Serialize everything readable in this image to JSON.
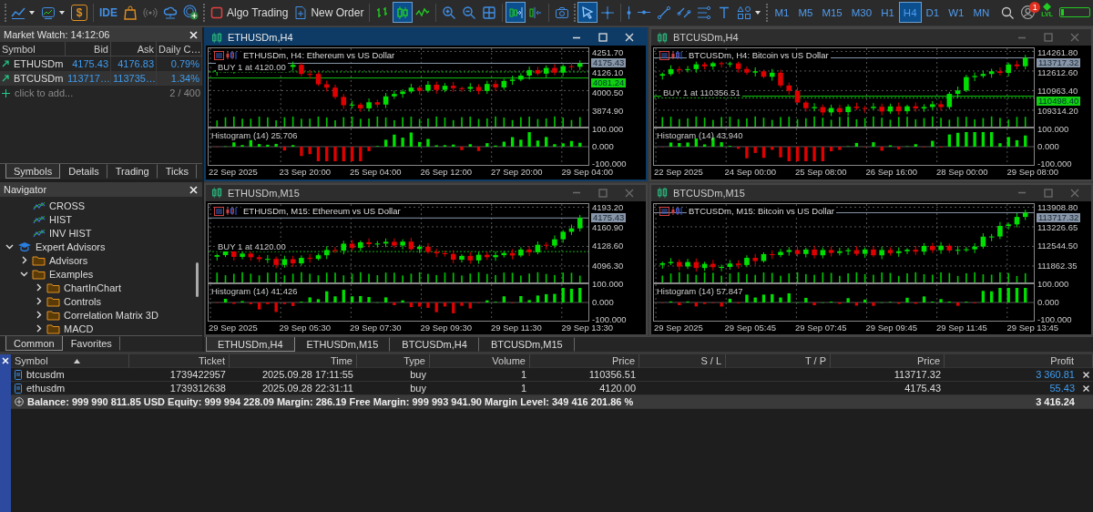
{
  "toolbar": {
    "ide": "IDE",
    "deposit_symbol": "$",
    "algo_trading": "Algo Trading",
    "new_order": "New Order",
    "toggles": [
      {
        "selected": false
      },
      {
        "selected": true
      },
      {
        "selected": false
      },
      {
        "selected": false
      },
      {
        "selected": false
      },
      {
        "selected": false
      },
      {
        "selected": true
      },
      {
        "selected": false
      },
      {
        "selected": false
      },
      {
        "selected": true
      },
      {
        "selected": false
      },
      {
        "selected": false
      },
      {
        "selected": false
      },
      {
        "selected": false
      },
      {
        "selected": false
      },
      {
        "selected": false
      },
      {
        "selected": false
      },
      {
        "selected": false
      }
    ],
    "timeframes": [
      {
        "label": "M1",
        "selected": false
      },
      {
        "label": "M5",
        "selected": false
      },
      {
        "label": "M15",
        "selected": false
      },
      {
        "label": "M30",
        "selected": false
      },
      {
        "label": "H1",
        "selected": false
      },
      {
        "label": "H4",
        "selected": true
      },
      {
        "label": "D1",
        "selected": false
      },
      {
        "label": "W1",
        "selected": false
      },
      {
        "label": "MN",
        "selected": false
      }
    ],
    "notification_count": "1",
    "level_label": "LVL"
  },
  "market_watch": {
    "title": "Market Watch: 14:12:06",
    "columns": [
      "Symbol",
      "Bid",
      "Ask",
      "Daily C…"
    ],
    "rows": [
      {
        "symbol": "ETHUSDm",
        "bid": "4175.43",
        "ask": "4176.83",
        "change": "0.79%",
        "selected": false
      },
      {
        "symbol": "BTCUSDm",
        "bid": "113717…",
        "ask": "113735…",
        "change": "1.34%",
        "selected": true
      }
    ],
    "add_label": "click to add...",
    "count": "2 / 400",
    "tabs": [
      {
        "label": "Symbols",
        "selected": true
      },
      {
        "label": "Details",
        "selected": false
      },
      {
        "label": "Trading",
        "selected": false
      },
      {
        "label": "Ticks",
        "selected": false
      }
    ]
  },
  "navigator": {
    "title": "Navigator",
    "tree": [
      {
        "label": "CROSS",
        "kind": "indicator"
      },
      {
        "label": "HIST",
        "kind": "indicator"
      },
      {
        "label": "INV HIST",
        "kind": "indicator"
      },
      {
        "label": "Expert Advisors",
        "kind": "experts",
        "expanded": true,
        "children": [
          {
            "label": "Advisors",
            "kind": "folder",
            "expanded": false
          },
          {
            "label": "Examples",
            "kind": "folder",
            "expanded": true,
            "children": [
              {
                "label": "ChartInChart",
                "kind": "folder",
                "expanded": false
              },
              {
                "label": "Controls",
                "kind": "folder",
                "expanded": false
              },
              {
                "label": "Correlation Matrix 3D",
                "kind": "folder",
                "expanded": false
              },
              {
                "label": "MACD",
                "kind": "folder",
                "expanded": false
              }
            ]
          }
        ]
      }
    ],
    "tabs": [
      {
        "label": "Common",
        "selected": true
      },
      {
        "label": "Favorites",
        "selected": false
      }
    ]
  },
  "charts": [
    {
      "title": "ETHUSDm,H4",
      "active": true,
      "header": "ETHUSDm, H4:  Ethereum vs US Dollar",
      "order_label": "BUY 1 at 4120.00",
      "price_ticks": [
        "4251.70",
        "4126.10",
        "4000.50",
        "3874.90"
      ],
      "price_tags": [
        {
          "value": "4175.43",
          "kind": "bid"
        },
        {
          "value": "4081.24",
          "kind": "level"
        }
      ],
      "indicator": "Histogram (14) 25.706",
      "indicator_ticks": [
        "100.000",
        "0.000",
        "-100.000"
      ],
      "time_labels": [
        "22 Sep 2025",
        "23 Sep 20:00",
        "25 Sep 04:00",
        "26 Sep 12:00",
        "27 Sep 20:00",
        "29 Sep 04:00"
      ]
    },
    {
      "title": "BTCUSDm,H4",
      "active": false,
      "header": "BTCUSDm, H4:  Bitcoin vs US Dollar",
      "order_label": "BUY 1 at 110356.51",
      "price_ticks": [
        "114261.80",
        "112612.60",
        "110963.40",
        "109314.20"
      ],
      "price_tags": [
        {
          "value": "113717.32",
          "kind": "bid"
        },
        {
          "value": "110498.40",
          "kind": "level"
        }
      ],
      "indicator": "Histogram (14) 43.940",
      "indicator_ticks": [
        "100.000",
        "0.000",
        "-100.000"
      ],
      "time_labels": [
        "22 Sep 2025",
        "24 Sep 00:00",
        "25 Sep 08:00",
        "26 Sep 16:00",
        "28 Sep 00:00",
        "29 Sep 08:00"
      ]
    },
    {
      "title": "ETHUSDm,M15",
      "active": false,
      "header": "ETHUSDm, M15:  Ethereum vs US Dollar",
      "order_label": "BUY 1 at 4120.00",
      "price_ticks": [
        "4193.20",
        "4160.90",
        "4128.60",
        "4096.30"
      ],
      "price_tags": [
        {
          "value": "4175.43",
          "kind": "bid"
        }
      ],
      "indicator": "Histogram (14) 41.426",
      "indicator_ticks": [
        "100.000",
        "0.000",
        "-100.000"
      ],
      "time_labels": [
        "29 Sep 2025",
        "29 Sep 05:30",
        "29 Sep 07:30",
        "29 Sep 09:30",
        "29 Sep 11:30",
        "29 Sep 13:30"
      ]
    },
    {
      "title": "BTCUSDm,M15",
      "active": false,
      "header": "BTCUSDm, M15:  Bitcoin vs US Dollar",
      "price_ticks": [
        "113908.80",
        "113226.65",
        "112544.50",
        "111862.35"
      ],
      "price_tags": [
        {
          "value": "113717.32",
          "kind": "bid"
        }
      ],
      "indicator": "Histogram (14) 57.847",
      "indicator_ticks": [
        "100.000",
        "0.000",
        "-100.000"
      ],
      "time_labels": [
        "29 Sep 2025",
        "29 Sep 05:45",
        "29 Sep 07:45",
        "29 Sep 09:45",
        "29 Sep 11:45",
        "29 Sep 13:45"
      ]
    }
  ],
  "chart_tabs": [
    {
      "label": "ETHUSDm,H4",
      "selected": true
    },
    {
      "label": "ETHUSDm,M15",
      "selected": false
    },
    {
      "label": "BTCUSDm,H4",
      "selected": false
    },
    {
      "label": "BTCUSDm,M15",
      "selected": false
    }
  ],
  "toolbox": {
    "columns": [
      "Symbol",
      "Ticket",
      "Time",
      "Type",
      "Volume",
      "Price",
      "S / L",
      "T / P",
      "Price",
      "Profit"
    ],
    "rows": [
      {
        "symbol": "btcusdm",
        "ticket": "1739422957",
        "time": "2025.09.28 17:11:55",
        "type": "buy",
        "volume": "1",
        "price": "110356.51",
        "current_price": "113717.32",
        "profit": "3 360.81"
      },
      {
        "symbol": "ethusdm",
        "ticket": "1739312638",
        "time": "2025.09.28 22:31:11",
        "type": "buy",
        "volume": "1",
        "price": "4120.00",
        "current_price": "4175.43",
        "profit": "55.43"
      }
    ],
    "summary": "Balance: 999 990 811.85 USD  Equity: 999 994 228.09  Margin: 286.19  Free Margin: 999 993 941.90  Margin Level: 349 416 201.86 %",
    "total_profit": "3 416.24"
  }
}
